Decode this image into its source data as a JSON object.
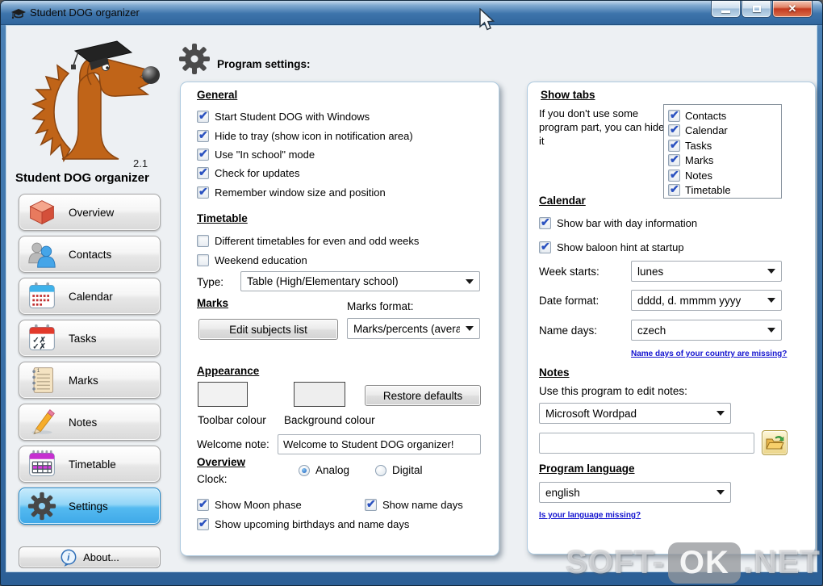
{
  "window": {
    "title": "Student DOG organizer"
  },
  "sidebar": {
    "version": "2.1",
    "app_title": "Student DOG organizer",
    "items": [
      {
        "label": "Overview",
        "icon": "cube-icon",
        "selected": false
      },
      {
        "label": "Contacts",
        "icon": "contacts-icon",
        "selected": false
      },
      {
        "label": "Calendar",
        "icon": "calendar-icon",
        "selected": false
      },
      {
        "label": "Tasks",
        "icon": "tasks-icon",
        "selected": false
      },
      {
        "label": "Marks",
        "icon": "marks-icon",
        "selected": false
      },
      {
        "label": "Notes",
        "icon": "pencil-icon",
        "selected": false
      },
      {
        "label": "Timetable",
        "icon": "timetable-icon",
        "selected": false
      },
      {
        "label": "Settings",
        "icon": "gear-icon",
        "selected": true
      }
    ],
    "about_label": "About..."
  },
  "header": {
    "title": "Program settings:"
  },
  "left_panel": {
    "general": {
      "heading": "General",
      "items": [
        {
          "label": "Start Student DOG with Windows",
          "checked": true
        },
        {
          "label": "Hide to tray (show icon in notification area)",
          "checked": true
        },
        {
          "label": "Use \"In school\" mode",
          "checked": true
        },
        {
          "label": "Check for updates",
          "checked": true
        },
        {
          "label": "Remember window size and position",
          "checked": true
        }
      ]
    },
    "timetable": {
      "heading": "Timetable",
      "items": [
        {
          "label": "Different timetables for even and odd weeks",
          "checked": false
        },
        {
          "label": "Weekend education",
          "checked": false
        }
      ],
      "type_label": "Type:",
      "type_value": "Table (High/Elementary school)"
    },
    "marks": {
      "heading": "Marks",
      "edit_subjects_button": "Edit subjects list",
      "format_label": "Marks format:",
      "format_value": "Marks/percents (avera"
    },
    "appearance": {
      "heading": "Appearance",
      "toolbar_colour_label": "Toolbar colour",
      "background_colour_label": "Background colour",
      "toolbar_swatch_color": "#f2f2f2",
      "background_swatch_color": "#eeeeee",
      "restore_defaults_button": "Restore defaults",
      "welcome_note_label": "Welcome note:",
      "welcome_note_value": "Welcome to Student DOG organizer!"
    },
    "overview": {
      "heading": "Overview",
      "clock_label": "Clock:",
      "clock_options": [
        {
          "label": "Analog",
          "selected": true
        },
        {
          "label": "Digital",
          "selected": false
        }
      ],
      "items": [
        {
          "label": "Show Moon phase",
          "checked": true
        },
        {
          "label": "Show name days",
          "checked": true
        },
        {
          "label": "Show upcoming birthdays and name days",
          "checked": true
        }
      ]
    }
  },
  "right_panel": {
    "show_tabs": {
      "heading": "Show tabs",
      "description": "If you don't use some program part, you can hide it",
      "tabs": [
        {
          "label": "Contacts",
          "checked": true
        },
        {
          "label": "Calendar",
          "checked": true
        },
        {
          "label": "Tasks",
          "checked": true
        },
        {
          "label": "Marks",
          "checked": true
        },
        {
          "label": "Notes",
          "checked": true
        },
        {
          "label": "Timetable",
          "checked": true
        }
      ]
    },
    "calendar": {
      "heading": "Calendar",
      "items": [
        {
          "label": "Show bar with day information",
          "checked": true
        },
        {
          "label": "Show baloon hint at startup",
          "checked": true
        }
      ],
      "week_starts_label": "Week starts:",
      "week_starts_value": "lunes",
      "date_format_label": "Date format:",
      "date_format_value": "dddd, d. mmmm yyyy",
      "name_days_label": "Name days:",
      "name_days_value": "czech",
      "name_days_link": "Name days of your country are missing?"
    },
    "notes": {
      "heading": "Notes",
      "description": "Use this program to edit notes:",
      "editor_value": "Microsoft Wordpad",
      "path_value": ""
    },
    "language": {
      "heading": "Program language",
      "value": "english",
      "link": "Is your language missing?"
    }
  },
  "watermark": {
    "part1": "SOFT-",
    "part2": "OK",
    "part3": ".NET"
  },
  "colors": {
    "selected_item_blue": "#3ea8e8",
    "link_blue": "#1313cf",
    "check_blue": "#2b52c0"
  }
}
